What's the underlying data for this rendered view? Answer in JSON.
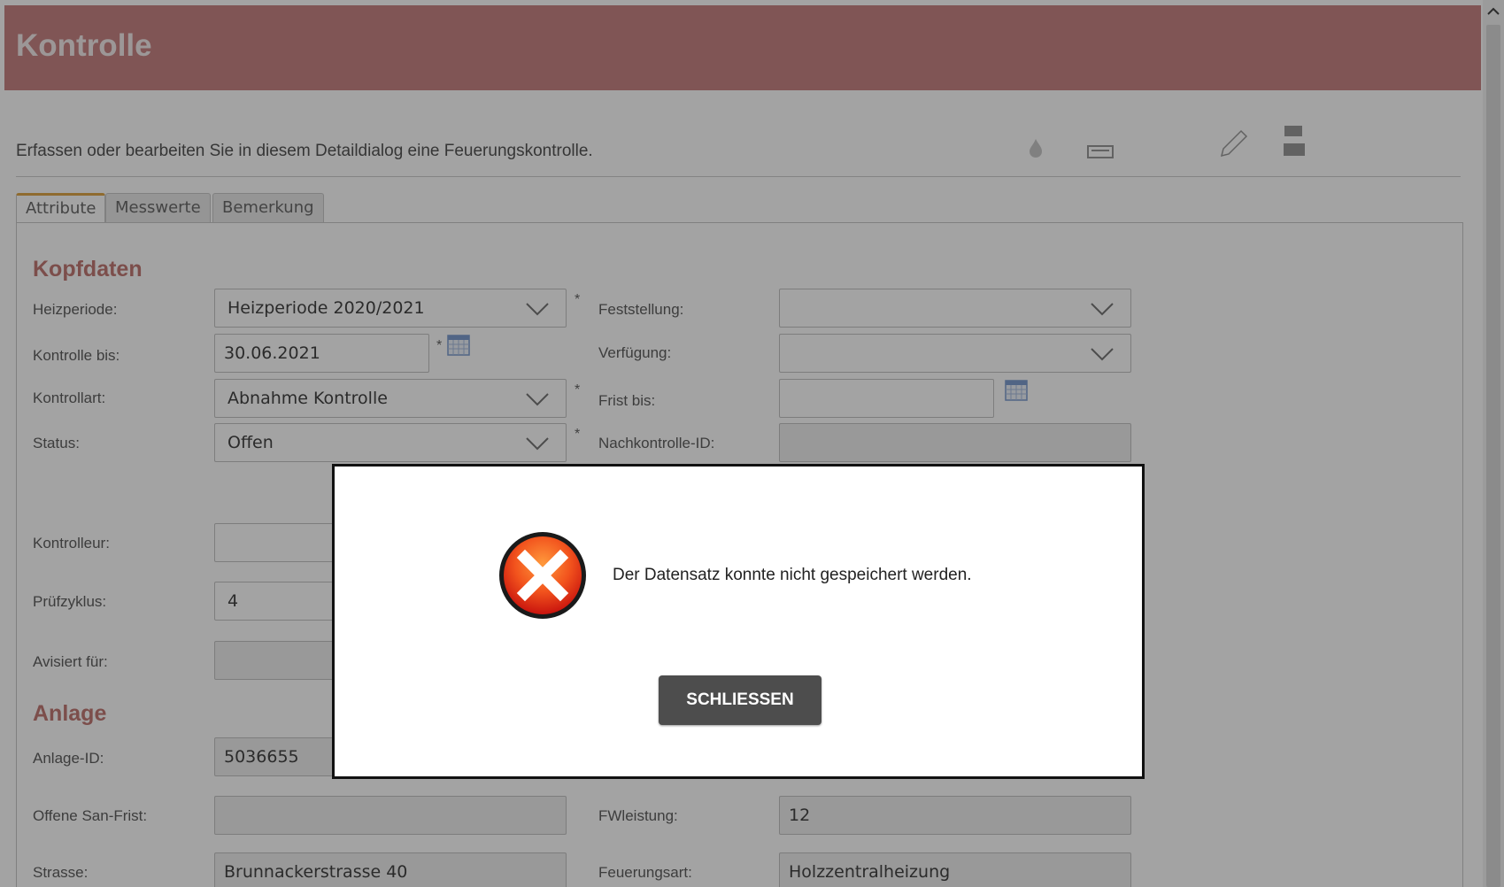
{
  "window": {
    "title": "Kontrolle"
  },
  "description": "Erfassen oder bearbeiten Sie in diesem Detaildialog eine Feuerungskontrolle.",
  "toolbar": {
    "icons": [
      "flame-icon",
      "print-icon",
      "checkmark-icon",
      "clipboard-edit-icon",
      "save-icon",
      "close-icon"
    ]
  },
  "tabs": [
    {
      "label": "Attribute",
      "active": true
    },
    {
      "label": "Messwerte",
      "active": false
    },
    {
      "label": "Bemerkung",
      "active": false
    }
  ],
  "kopfdaten": {
    "heading": "Kopfdaten",
    "heizperiode": {
      "label": "Heizperiode:",
      "value": "Heizperiode 2020/2021"
    },
    "kontrolle_bis": {
      "label": "Kontrolle bis:",
      "value": "30.06.2021"
    },
    "kontrollart": {
      "label": "Kontrollart:",
      "value": "Abnahme Kontrolle"
    },
    "status": {
      "label": "Status:",
      "value": "Offen"
    },
    "kontrolleur": {
      "label": "Kontrolleur:",
      "value": ""
    },
    "pruefzyklus": {
      "label": "Prüfzyklus:",
      "value": "4"
    },
    "avisiert_fuer": {
      "label": "Avisiert für:",
      "value": ""
    },
    "feststellung": {
      "label": "Feststellung:",
      "value": ""
    },
    "verfuegung": {
      "label": "Verfügung:",
      "value": ""
    },
    "frist_bis": {
      "label": "Frist bis:",
      "value": ""
    },
    "nachkontrolle_id": {
      "label": "Nachkontrolle-ID:",
      "value": ""
    },
    "required_marker": "*"
  },
  "anlage": {
    "heading": "Anlage",
    "anlage_id": {
      "label": "Anlage-ID:",
      "value": "5036655"
    },
    "offene_san_frist": {
      "label": "Offene San-Frist:",
      "value": ""
    },
    "strasse": {
      "label": "Strasse:",
      "value": "Brunnackerstrasse 40"
    },
    "fwleistung": {
      "label": "FWleistung:",
      "value": "12"
    },
    "feuerungsart": {
      "label": "Feuerungsart:",
      "value": "Holzzentralheizung"
    }
  },
  "dialog": {
    "message": "Der Datensatz konnte nicht gespeichert werden.",
    "button_label": "SCHLIESSEN",
    "icon": "error-icon"
  },
  "colors": {
    "titlebar": "#c98585",
    "section_heading": "#c27a76",
    "active_tab_accent": "#e0a84a",
    "dialog_button": "#4d4d4d",
    "error_red": "#e8361e"
  }
}
